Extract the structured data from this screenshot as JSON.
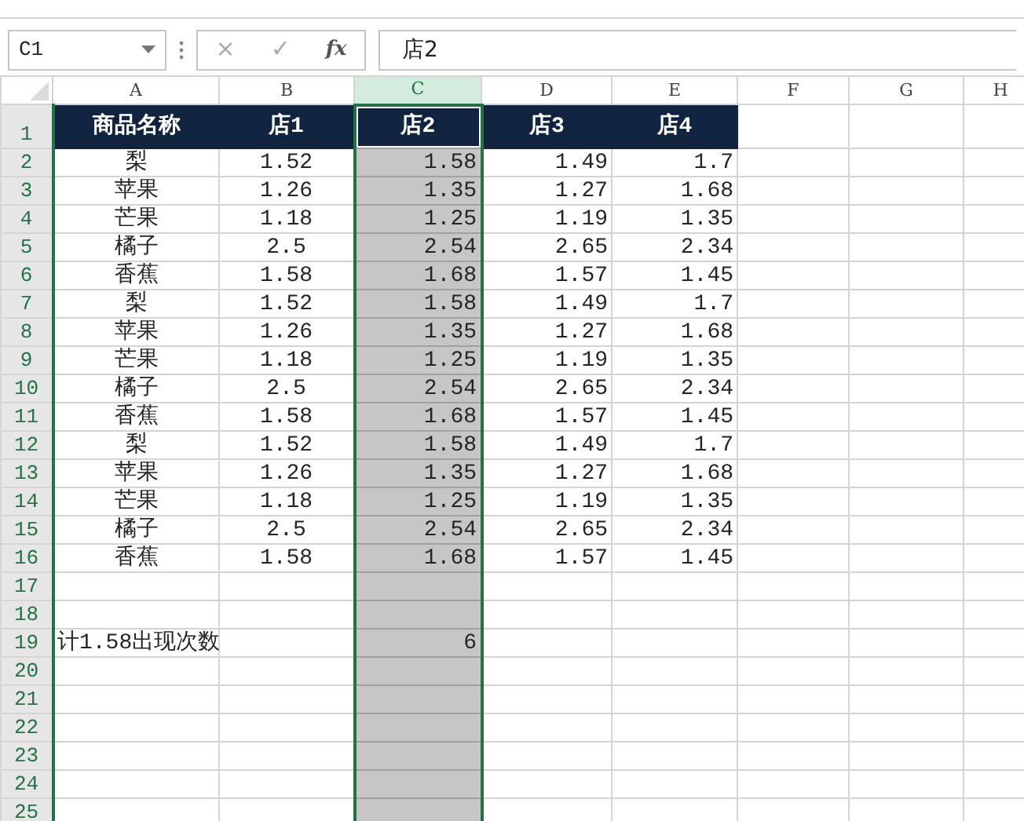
{
  "name_box": "C1",
  "formula_buttons": [
    "×",
    "✓",
    "fx"
  ],
  "formula": "店2",
  "columns": [
    {
      "label": "A",
      "selected": false
    },
    {
      "label": "B",
      "selected": false
    },
    {
      "label": "C",
      "selected": true
    },
    {
      "label": "D",
      "selected": false
    },
    {
      "label": "E",
      "selected": false
    },
    {
      "label": "F",
      "selected": false
    },
    {
      "label": "G",
      "selected": false
    },
    {
      "label": "H",
      "selected": false
    }
  ],
  "rows": [
    {
      "number": "1",
      "kind": "header",
      "cells": [
        "商品名称",
        "店1",
        "店2",
        "店3",
        "店4"
      ]
    },
    {
      "number": "2",
      "cells": [
        "梨",
        "1.52",
        "1.58",
        "1.49",
        "1.7"
      ]
    },
    {
      "number": "3",
      "cells": [
        "苹果",
        "1.26",
        "1.35",
        "1.27",
        "1.68"
      ]
    },
    {
      "number": "4",
      "cells": [
        "芒果",
        "1.18",
        "1.25",
        "1.19",
        "1.35"
      ]
    },
    {
      "number": "5",
      "cells": [
        "橘子",
        "2.5",
        "2.54",
        "2.65",
        "2.34"
      ]
    },
    {
      "number": "6",
      "cells": [
        "香蕉",
        "1.58",
        "1.68",
        "1.57",
        "1.45"
      ]
    },
    {
      "number": "7",
      "cells": [
        "梨",
        "1.52",
        "1.58",
        "1.49",
        "1.7"
      ]
    },
    {
      "number": "8",
      "cells": [
        "苹果",
        "1.26",
        "1.35",
        "1.27",
        "1.68"
      ]
    },
    {
      "number": "9",
      "cells": [
        "芒果",
        "1.18",
        "1.25",
        "1.19",
        "1.35"
      ]
    },
    {
      "number": "10",
      "cells": [
        "橘子",
        "2.5",
        "2.54",
        "2.65",
        "2.34"
      ]
    },
    {
      "number": "11",
      "cells": [
        "香蕉",
        "1.58",
        "1.68",
        "1.57",
        "1.45"
      ]
    },
    {
      "number": "12",
      "cells": [
        "梨",
        "1.52",
        "1.58",
        "1.49",
        "1.7"
      ]
    },
    {
      "number": "13",
      "cells": [
        "苹果",
        "1.26",
        "1.35",
        "1.27",
        "1.68"
      ]
    },
    {
      "number": "14",
      "cells": [
        "芒果",
        "1.18",
        "1.25",
        "1.19",
        "1.35"
      ]
    },
    {
      "number": "15",
      "cells": [
        "橘子",
        "2.5",
        "2.54",
        "2.65",
        "2.34"
      ]
    },
    {
      "number": "16",
      "cells": [
        "香蕉",
        "1.58",
        "1.68",
        "1.57",
        "1.45"
      ]
    },
    {
      "number": "17",
      "cells": []
    },
    {
      "number": "18",
      "cells": []
    },
    {
      "number": "19",
      "cells": [
        "计1.58出现次数",
        "",
        "6"
      ]
    },
    {
      "number": "20",
      "cells": []
    },
    {
      "number": "21",
      "cells": []
    },
    {
      "number": "22",
      "cells": []
    },
    {
      "number": "23",
      "cells": []
    },
    {
      "number": "24",
      "cells": []
    },
    {
      "number": "25",
      "cells": []
    }
  ]
}
